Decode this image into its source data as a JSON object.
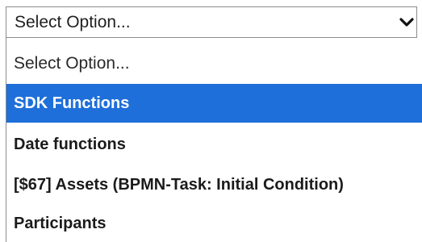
{
  "select": {
    "current_value": "Select Option...",
    "chevron_icon": "chevron-down-icon"
  },
  "options": [
    {
      "label": "Select Option..."
    },
    {
      "label": "SDK Functions"
    },
    {
      "label": "Date functions"
    },
    {
      "label": "[$67] Assets (BPMN-Task: Initial Condition)"
    },
    {
      "label": "Participants"
    }
  ],
  "colors": {
    "highlight": "#1e6fd9",
    "border": "#8c8c8c"
  }
}
